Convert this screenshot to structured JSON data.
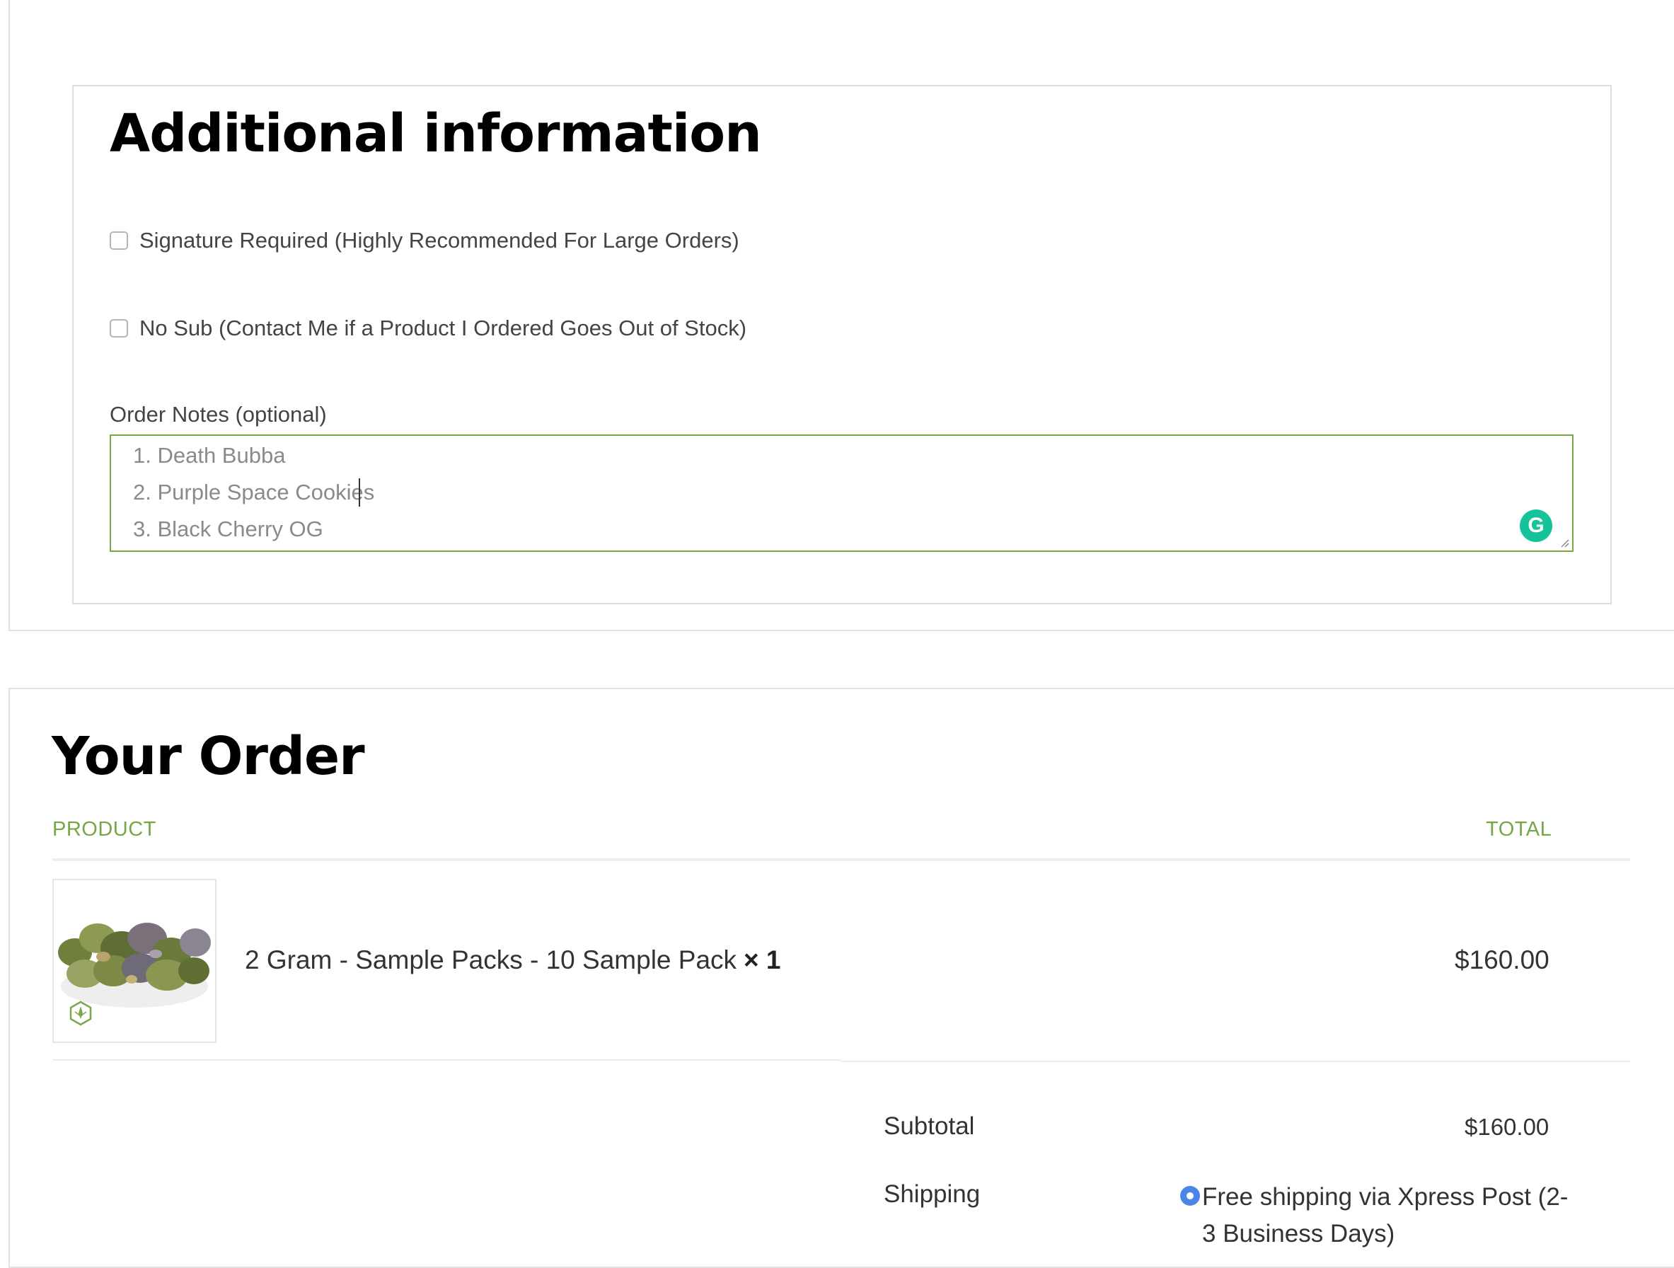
{
  "additional": {
    "title": "Additional information",
    "checkboxes": [
      {
        "label": "Signature Required (Highly Recommended For Large Orders)",
        "checked": false
      },
      {
        "label": "No Sub (Contact Me if a Product I Ordered Goes Out of Stock)",
        "checked": false
      }
    ],
    "notes_label": "Order Notes (optional)",
    "notes_lines": [
      "1. Death Bubba",
      "2. Purple Space Cookies",
      "3. Black Cherry OG"
    ],
    "grammarly_glyph": "G"
  },
  "order": {
    "title": "Your Order",
    "columns": {
      "product": "PRODUCT",
      "total": "TOTAL"
    },
    "item": {
      "name": "2 Gram - Sample Packs - 10 Sample Pack",
      "qty": "× 1",
      "price": "$160.00",
      "thumbnail": "cannabis-buds-image"
    },
    "subtotal_label": "Subtotal",
    "subtotal_value": "$160.00",
    "shipping_label": "Shipping",
    "shipping_option": "Free shipping via Xpress Post (2-3 Business Days)"
  },
  "colors": {
    "accent_green": "#77a745",
    "grammarly": "#15c39a",
    "radio_blue": "#4a86e8"
  }
}
